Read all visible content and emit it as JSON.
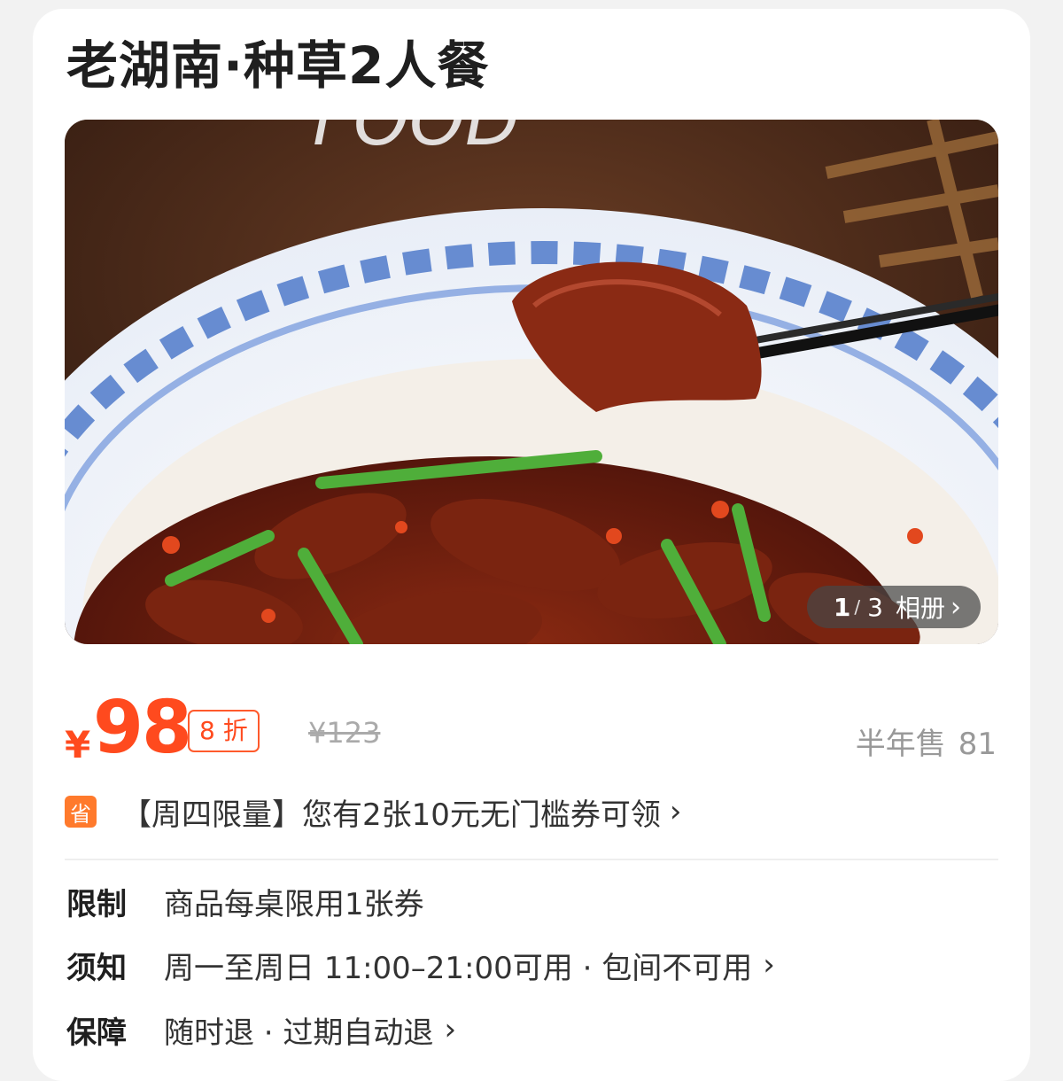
{
  "deal": {
    "title": "老湖南·种草2人餐"
  },
  "gallery": {
    "current": "1",
    "separator": "/",
    "total": "3",
    "album_label": "相册",
    "album_icon": "chevron-right-icon",
    "overlay_text": "FOOD"
  },
  "price": {
    "currency": "¥",
    "current": "98",
    "discount": "8 折",
    "original": "¥123",
    "sold_label": "半年售",
    "sold_count": "81",
    "accent_color": "#ff4a1e"
  },
  "coupon": {
    "badge": "省",
    "text": "【周四限量】您有2张10元无门槛券可领",
    "chevron_icon": "chevron-right-icon"
  },
  "info": [
    {
      "label": "限制",
      "value": "商品每桌限用1张券",
      "has_chevron": false
    },
    {
      "label": "须知",
      "value": "周一至周日 11:00–21:00可用 · 包间不可用",
      "has_chevron": true
    },
    {
      "label": "保障",
      "value": "随时退 · 过期自动退",
      "has_chevron": true
    }
  ]
}
